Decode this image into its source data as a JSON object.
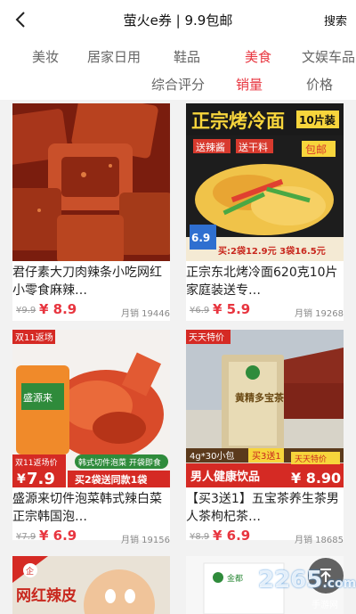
{
  "header": {
    "back_icon": "chevron-left-icon",
    "title": "萤火e券 | 9.9包邮",
    "search_label": "搜索"
  },
  "categories": [
    {
      "label": "美妆",
      "active": false
    },
    {
      "label": "居家日用",
      "active": false
    },
    {
      "label": "鞋品",
      "active": false
    },
    {
      "label": "美食",
      "active": true
    },
    {
      "label": "文娱车品",
      "active": false
    }
  ],
  "sort_tabs": [
    {
      "label": "综合评分",
      "active": false
    },
    {
      "label": "销量",
      "active": true
    },
    {
      "label": "价格",
      "active": false
    }
  ],
  "products": [
    {
      "name": "君仔素大刀肉辣条小吃网红小零食麻辣…",
      "old_price": "¥9.9",
      "price": "¥ 8.9",
      "sales": "月销 19446",
      "image": {
        "type": "spicy-gluten-strips"
      }
    },
    {
      "name": "正宗东北烤冷面620克10片家庭装送专…",
      "old_price": "¥6.9",
      "price": "¥ 5.9",
      "sales": "月销 19268",
      "image": {
        "type": "cold-noodle-pack",
        "banner": "正宗烤冷面",
        "tag": "10片装",
        "sub1": "送辣酱",
        "sub2": "送干料",
        "badge": "包邮",
        "price_tag": "6.9",
        "promo": "买:2袋12.9元 3袋16.5元"
      }
    },
    {
      "name": "盛源来切件泡菜韩式辣白菜正宗韩国泡…",
      "old_price": "¥7.9",
      "price": "¥ 6.9",
      "sales": "月销 19156",
      "image": {
        "type": "kimchi",
        "corner_tag": "双11返场",
        "brand": "盛源来",
        "pill": "韩式切件泡菜 开袋即食",
        "offer": "买2袋送同款1袋",
        "small_tag": "双11返场价",
        "big_price": "7.9"
      }
    },
    {
      "name": "【买3送1】五宝茶养生茶男人茶枸杞茶…",
      "old_price": "¥8.9",
      "price": "¥ 6.9",
      "sales": "月销 18685",
      "image": {
        "type": "tea-box",
        "corner_tag": "天天特价",
        "box_text": "黄精多宝茶",
        "pack_info": "4g*30小包",
        "buy_offer": "买3送1",
        "slogan": "男人健康饮品",
        "day_tag": "天天特价",
        "big_price": "¥ 8.90"
      }
    },
    {
      "name": "",
      "old_price": "",
      "price": "",
      "sales": "",
      "image": {
        "type": "spicy-skin",
        "label": "网红辣皮"
      }
    },
    {
      "name": "",
      "old_price": "",
      "price": "",
      "sales": "",
      "image": {
        "type": "white-product",
        "label": "金都"
      }
    }
  ],
  "scroll_top": {
    "icon": "arrow-up-icon"
  },
  "watermark": {
    "text": "2265",
    "suffix": ".com",
    "sub": "手游网"
  }
}
